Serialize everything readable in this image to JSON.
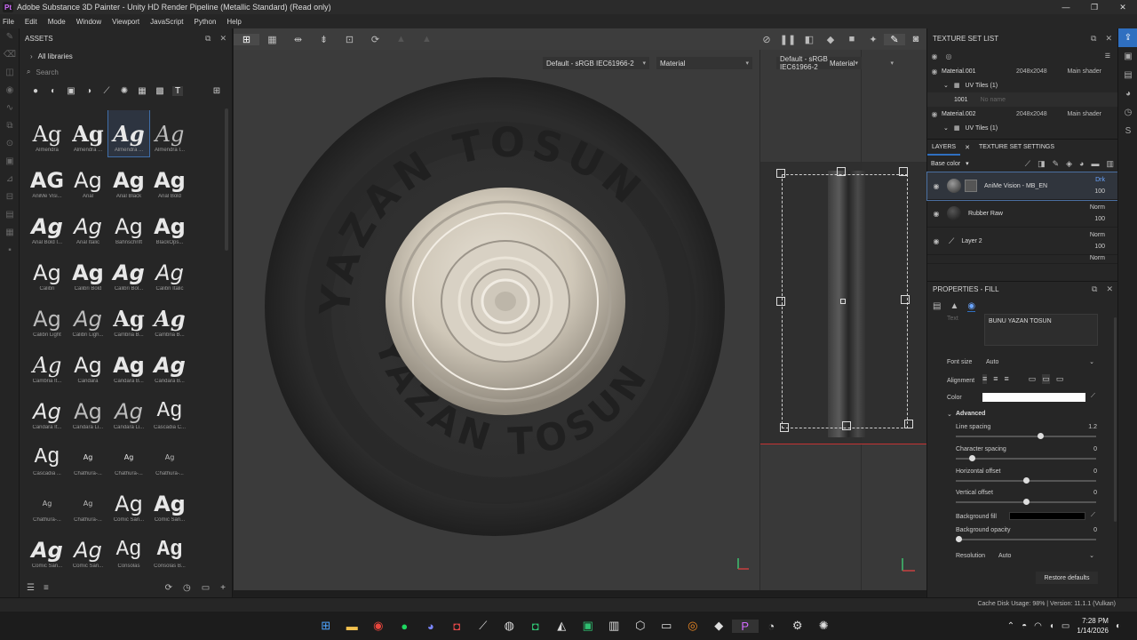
{
  "window": {
    "title": "Adobe Substance 3D Painter - Unity HD Render Pipeline (Metallic Standard) (Read only)",
    "logo_text": "Pt",
    "minimize": "—",
    "maximize": "❐",
    "close": "✕"
  },
  "menu": [
    "File",
    "Edit",
    "Mode",
    "Window",
    "Viewport",
    "JavaScript",
    "Python",
    "Help"
  ],
  "assets": {
    "title": "ASSETS",
    "libraries_label": "All libraries",
    "search_placeholder": "Search",
    "fonts": [
      {
        "glyph": "Ag",
        "name": "Almendra",
        "style": "serif"
      },
      {
        "glyph": "Ag",
        "name": "Almendra ...",
        "style": "serif bold"
      },
      {
        "glyph": "Ag",
        "name": "Almendra ...",
        "style": "serif bold ital",
        "selected": true
      },
      {
        "glyph": "Ag",
        "name": "Almendra I...",
        "style": "serif ital light"
      },
      {
        "glyph": "AG",
        "name": "AniMe Visi...",
        "style": "bold"
      },
      {
        "glyph": "Ag",
        "name": "Arial",
        "style": ""
      },
      {
        "glyph": "Ag",
        "name": "Arial Black",
        "style": "bold"
      },
      {
        "glyph": "Ag",
        "name": "Arial Bold",
        "style": "bold"
      },
      {
        "glyph": "Ag",
        "name": "Arial Bold I...",
        "style": "bold ital"
      },
      {
        "glyph": "Ag",
        "name": "Arial Italic",
        "style": "ital"
      },
      {
        "glyph": "Ag",
        "name": "Bahnschrift",
        "style": ""
      },
      {
        "glyph": "Ag",
        "name": "BlackOps...",
        "style": "bold"
      },
      {
        "glyph": "Ag",
        "name": "Calibri",
        "style": ""
      },
      {
        "glyph": "Ag",
        "name": "Calibri Bold",
        "style": "bold"
      },
      {
        "glyph": "Ag",
        "name": "Calibri Bol...",
        "style": "bold ital"
      },
      {
        "glyph": "Ag",
        "name": "Calibri Italic",
        "style": "ital"
      },
      {
        "glyph": "Ag",
        "name": "Calibri Light",
        "style": "light"
      },
      {
        "glyph": "Ag",
        "name": "Calibri Ligh...",
        "style": "ital light"
      },
      {
        "glyph": "Ag",
        "name": "Cambria B...",
        "style": "serif bold"
      },
      {
        "glyph": "Ag",
        "name": "Cambria B...",
        "style": "serif bold ital"
      },
      {
        "glyph": "Ag",
        "name": "Cambria It...",
        "style": "serif ital"
      },
      {
        "glyph": "Ag",
        "name": "Candara",
        "style": ""
      },
      {
        "glyph": "Ag",
        "name": "Candara B...",
        "style": "bold"
      },
      {
        "glyph": "Ag",
        "name": "Candara B...",
        "style": "bold ital"
      },
      {
        "glyph": "Ag",
        "name": "Candara It...",
        "style": "ital"
      },
      {
        "glyph": "Ag",
        "name": "Candara Li...",
        "style": "light"
      },
      {
        "glyph": "Ag",
        "name": "Candara Li...",
        "style": "ital light"
      },
      {
        "glyph": "Ag",
        "name": "Cascadia C...",
        "style": "mono"
      },
      {
        "glyph": "Ag",
        "name": "Cascadia ...",
        "style": "mono"
      },
      {
        "glyph": "Ag",
        "name": "Chathura-...",
        "style": "small"
      },
      {
        "glyph": "Ag",
        "name": "Chathura-...",
        "style": "small"
      },
      {
        "glyph": "Ag",
        "name": "Chathura-...",
        "style": "small light"
      },
      {
        "glyph": "Ag",
        "name": "Chathura-...",
        "style": "small light"
      },
      {
        "glyph": "Ag",
        "name": "Chathura-...",
        "style": "small light"
      },
      {
        "glyph": "Ag",
        "name": "Comic San...",
        "style": ""
      },
      {
        "glyph": "Ag",
        "name": "Comic San...",
        "style": "bold"
      },
      {
        "glyph": "Ag",
        "name": "Comic San...",
        "style": "bold ital"
      },
      {
        "glyph": "Ag",
        "name": "Comic San...",
        "style": "ital"
      },
      {
        "glyph": "Ag",
        "name": "Consolas",
        "style": "mono"
      },
      {
        "glyph": "Ag",
        "name": "Consolas B...",
        "style": "mono bold"
      }
    ]
  },
  "viewport": {
    "colorspace_3d": "Default - sRGB IEC61966-2",
    "channel_3d": "Material",
    "colorspace_2d": "Default - sRGB IEC61966-2",
    "channel_2d": "Material"
  },
  "texture_set_list": {
    "title": "TEXTURE SET LIST",
    "items": [
      {
        "name": "Material.001",
        "resolution": "2048x2048",
        "shader": "Main shader",
        "uv": "UV Tiles (1)",
        "tile": "1001",
        "tile_name": "No name"
      },
      {
        "name": "Material.002",
        "resolution": "2048x2048",
        "shader": "Main shader",
        "uv": "UV Tiles (1)"
      }
    ]
  },
  "layers": {
    "tab_layers": "LAYERS",
    "tab_settings": "TEXTURE SET SETTINGS",
    "channel": "Base color",
    "items": [
      {
        "name": "AniMe Vision - MB_EN",
        "blend": "Drk",
        "opacity": "100",
        "selected": true
      },
      {
        "name": "Rubber Raw",
        "blend": "Norm",
        "opacity": "100"
      },
      {
        "name": "Layer 2",
        "blend": "Norm",
        "opacity": "100"
      },
      {
        "name": "",
        "blend": "Norm",
        "opacity": ""
      }
    ]
  },
  "properties": {
    "title": "PROPERTIES - FILL",
    "text_label": "Text",
    "text_value": "BUNU YAZAN TOSUN",
    "font_size_label": "Font size",
    "font_size_value": "Auto",
    "alignment_label": "Alignment",
    "color_label": "Color",
    "color_value": "#ffffff",
    "advanced_label": "Advanced",
    "line_spacing_label": "Line spacing",
    "line_spacing_value": "1.2",
    "line_spacing_level": 0.61,
    "char_spacing_label": "Character spacing",
    "char_spacing_value": "0",
    "char_spacing_level": 0.1,
    "h_offset_label": "Horizontal offset",
    "h_offset_value": "0",
    "h_offset_level": 0.5,
    "v_offset_label": "Vertical offset",
    "v_offset_value": "0",
    "v_offset_level": 0.5,
    "bg_fill_label": "Background fill",
    "bg_fill_value": "#000000",
    "bg_opacity_label": "Background opacity",
    "bg_opacity_value": "0",
    "bg_opacity_level": 0.0,
    "resolution_label": "Resolution",
    "resolution_value": "Auto",
    "restore_label": "Restore defaults"
  },
  "status": {
    "cache": "Cache Disk Usage:   98% | Version: 11.1.1 (Vulkan)"
  },
  "taskbar": {
    "time": "7:28 PM",
    "date": "1/14/2026"
  },
  "tire_text": {
    "upper": "YAZAN TOSUN",
    "lower": "YAZAN TOSUN"
  }
}
